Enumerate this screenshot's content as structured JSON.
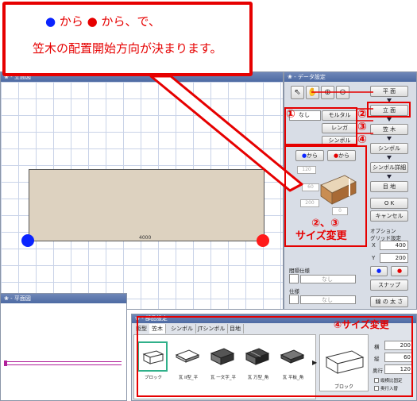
{
  "callout": {
    "line1_blue_dot": "●",
    "line1_text_a": "から",
    "line1_red_dot": "●",
    "line1_text_b": "から、で、",
    "line2": "笠木の配置開始方向が決まります。"
  },
  "elevation_window": {
    "title": "❀ - 立面図",
    "dimension_label": "4000"
  },
  "plan_window": {
    "title": "❀ - 平面図"
  },
  "data_window": {
    "title": "❀ - データ設定",
    "tools": [
      "pointer",
      "hand",
      "zoom-in",
      "zoom-out"
    ],
    "mode_buttons": [
      "平 面",
      "立 面",
      "笠 木",
      "シンボル",
      "シンボル詳細",
      "目 地",
      "O K",
      "キャンセル"
    ],
    "type_label": "なし",
    "type_buttons": [
      "モルタル",
      "レンガ",
      "シンボル"
    ],
    "direction_buttons": [
      "から",
      "から"
    ],
    "dims": [
      "120",
      "60",
      "200",
      "0"
    ],
    "option_label": "オプション",
    "grid_label": "グリッド設定",
    "grid_x_label": "X",
    "grid_x_value": "400",
    "grid_y_label": "Y",
    "grid_y_value": "200",
    "snap_button": "スナップ",
    "line_width_button": "線 の 太 さ",
    "joint_spec_label": "間隔仕様",
    "joint_spec_value": "なし",
    "spec_label": "仕様",
    "spec_value": "なし"
  },
  "annotations": {
    "num1": "①",
    "num2": "②",
    "num3": "③",
    "num4": "④",
    "size_change_line1": "②、③",
    "size_change_line2": "サイズ変更",
    "size_change_bottom": "④サイズ変更"
  },
  "parts_window": {
    "title": "❀ - 部品設定",
    "tabs": [
      "躯型",
      "笠木",
      "シンボル",
      "JTシンボル",
      "目地"
    ],
    "items": [
      {
        "caption": "ブロック"
      },
      {
        "caption": "瓦 II型_平"
      },
      {
        "caption": "瓦 一文字_平"
      },
      {
        "caption": "瓦 万型_角"
      },
      {
        "caption": "瓦 平板_角"
      }
    ],
    "preview_caption": "ブロック",
    "fields": [
      {
        "label": "横",
        "value": "200"
      },
      {
        "label": "縦",
        "value": "60"
      },
      {
        "label": "奥行",
        "value": "120"
      }
    ],
    "checkboxes": [
      "縦横比固定",
      "奥行入替"
    ]
  },
  "colors": {
    "accent_red": "#e60000",
    "dot_blue": "#0a24ff",
    "dot_red": "#ff1a1a",
    "wall_fill": "#ddd2c0"
  }
}
